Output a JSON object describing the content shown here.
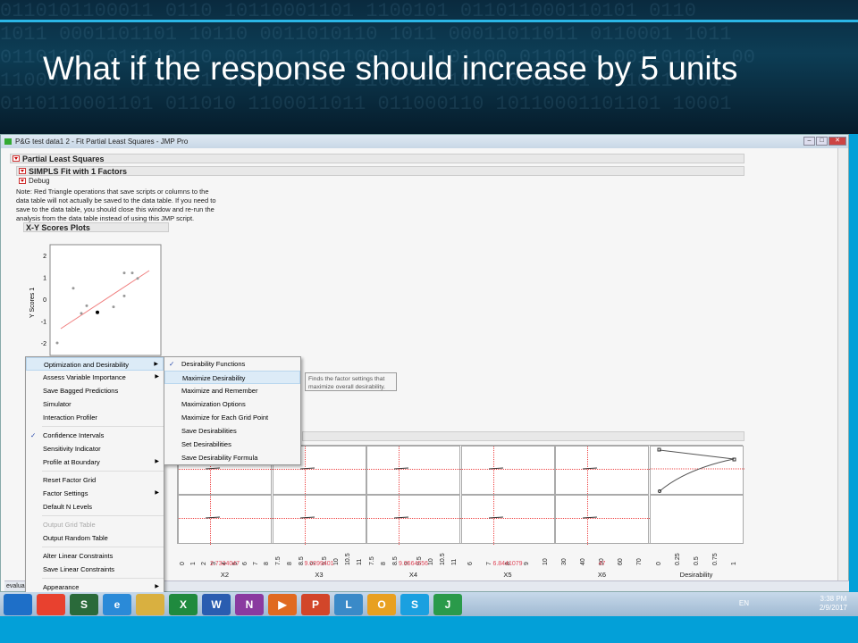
{
  "slide_title": "What if the response should increase by 5 units",
  "window": {
    "title": "P&G test data1 2 - Fit Partial Least Squares - JMP Pro"
  },
  "report": {
    "pls": "Partial Least Squares",
    "simpls": "SIMPLS Fit with 1 Factors",
    "debug": "Debug",
    "note": "Note: Red Triangle operations that save scripts or columns to the data table will not actually be saved to the data table. If you need to save to the data table, you should close this window and re-run the analysis from the data table instead of using this JMP script.",
    "xy_scores": "X-Y Scores Plots",
    "y_axis_label": "Y Scores 1",
    "y_ticks": [
      "2",
      "1",
      "0",
      "-1",
      "-2"
    ]
  },
  "menu": {
    "items": [
      {
        "label": "Optimization and Desirability",
        "sub": true,
        "hl": true
      },
      {
        "label": "Assess Variable Importance",
        "sub": true
      },
      {
        "label": "Save Bagged Predictions"
      },
      {
        "label": "Simulator"
      },
      {
        "label": "Interaction Profiler",
        "sepAfter": true
      },
      {
        "label": "Confidence Intervals",
        "checked": true
      },
      {
        "label": "Sensitivity Indicator"
      },
      {
        "label": "Profile at Boundary",
        "sub": true,
        "sepAfter": true
      },
      {
        "label": "Reset Factor Grid"
      },
      {
        "label": "Factor Settings",
        "sub": true
      },
      {
        "label": "Default N Levels",
        "sepAfter": true
      },
      {
        "label": "Output Grid Table",
        "disabled": true
      },
      {
        "label": "Output Random Table",
        "sepAfter": true
      },
      {
        "label": "Alter Linear Constraints"
      },
      {
        "label": "Save Linear Constraints",
        "sepAfter": true
      },
      {
        "label": "Appearance",
        "sub": true
      }
    ]
  },
  "submenu": {
    "items": [
      {
        "label": "Desirability Functions",
        "checked": true
      },
      {
        "label": "Maximize Desirability",
        "hl": true
      },
      {
        "label": "Maximize and Remember"
      },
      {
        "label": "Maximization Options"
      },
      {
        "label": "Maximize for Each Grid Point"
      },
      {
        "label": "Save Desirabilities"
      },
      {
        "label": "Set Desirabilities"
      },
      {
        "label": "Save Desirability Formula"
      }
    ]
  },
  "tooltip": "Finds the factor settings that maximize overall desirability.",
  "profiler": {
    "factors": [
      {
        "name": "X2",
        "value": "2.7324047",
        "ticks": [
          "0",
          "1",
          "2",
          "3",
          "4",
          "5",
          "6",
          "7",
          "8"
        ]
      },
      {
        "name": "X3",
        "value": "9.0399401",
        "ticks": [
          "7.5",
          "8",
          "8.5",
          "9",
          "9.5",
          "10",
          "10.5",
          "11"
        ]
      },
      {
        "name": "X4",
        "value": "9.0564556",
        "ticks": [
          "7.5",
          "8",
          "8.5",
          "9",
          "9.5",
          "10",
          "10.5",
          "11"
        ]
      },
      {
        "name": "X5",
        "value": "6.8441079",
        "ticks": [
          "6",
          "7",
          "8",
          "9",
          "10"
        ]
      },
      {
        "name": "X6",
        "value": "47",
        "ticks": [
          "30",
          "40",
          "50",
          "60",
          "70"
        ]
      },
      {
        "name": "Desirability",
        "value": "",
        "ticks": [
          "0",
          "0.25",
          "0.5",
          "0.75",
          "1"
        ]
      }
    ]
  },
  "status": "evalua",
  "taskbar": {
    "time": "3:38 PM",
    "date": "2/9/2017",
    "lang": "EN",
    "apps": [
      {
        "label": "",
        "color": "#1e6fc8"
      },
      {
        "label": "",
        "color": "#e8412f"
      },
      {
        "label": "S",
        "color": "#2a6a3a"
      },
      {
        "label": "e",
        "color": "#2a8ad8"
      },
      {
        "label": "",
        "color": "#d9b040"
      },
      {
        "label": "X",
        "color": "#1f8a3e"
      },
      {
        "label": "W",
        "color": "#2a5db0"
      },
      {
        "label": "N",
        "color": "#8a3aa0"
      },
      {
        "label": "▶",
        "color": "#e06a20"
      },
      {
        "label": "P",
        "color": "#d2462a"
      },
      {
        "label": "L",
        "color": "#3a8ac8"
      },
      {
        "label": "O",
        "color": "#e8a020"
      },
      {
        "label": "S",
        "color": "#1aa0e0"
      },
      {
        "label": "J",
        "color": "#2a9a4a"
      }
    ]
  }
}
